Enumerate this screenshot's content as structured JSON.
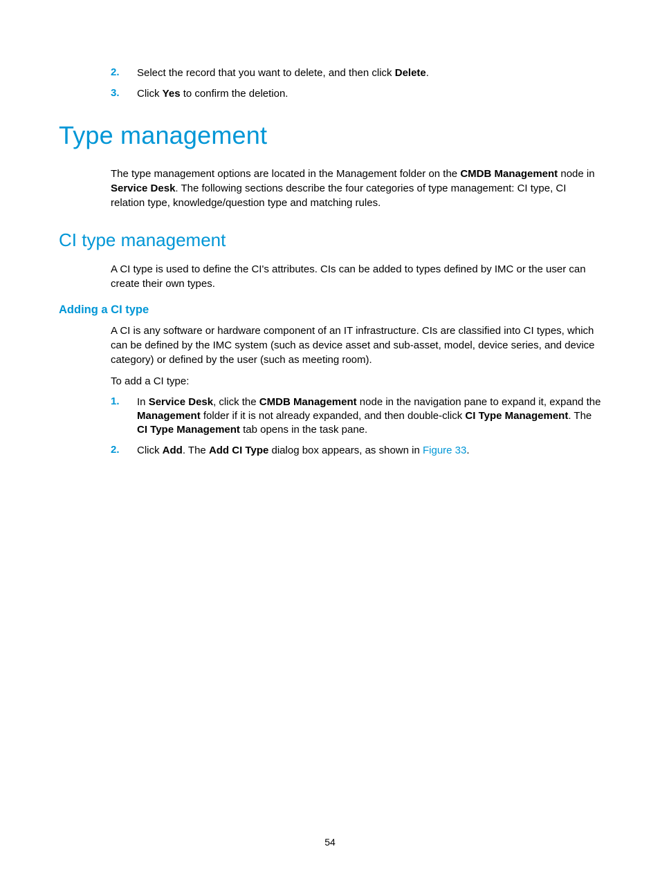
{
  "top_list": {
    "item2": {
      "num": "2.",
      "pre": "Select the record that you want to delete, and then click ",
      "bold": "Delete",
      "post": "."
    },
    "item3": {
      "num": "3.",
      "pre": "Click ",
      "bold": "Yes",
      "post": " to confirm the deletion."
    }
  },
  "h1": "Type management",
  "para1": {
    "t1": "The type management options are located in the Management folder on the ",
    "b1": "CMDB Management",
    "t2": " node in ",
    "b2": "Service Desk",
    "t3": ". The following sections describe the four categories of type management: CI type, CI relation type, knowledge/question type and matching rules."
  },
  "h2": "CI type management",
  "para2": "A CI type is used to define the CI's attributes. CIs can be added to types defined by IMC or the user can create their own types.",
  "h3": "Adding a CI type",
  "para3": "A CI is any software or hardware component of an IT infrastructure. CIs are classified into CI types, which can be defined by the IMC system (such as device asset and sub-asset, model, device series, and device category) or defined by the user (such as meeting room).",
  "para4": "To add a CI type:",
  "step1": {
    "num": "1.",
    "t1": "In ",
    "b1": "Service Desk",
    "t2": ", click the ",
    "b2": "CMDB Management",
    "t3": " node in the navigation pane to expand it, expand the ",
    "b3": "Management",
    "t4": " folder if it is not already expanded, and then double-click ",
    "b4": "CI Type Management",
    "t5": ". The ",
    "b5": "CI Type Management",
    "t6": " tab opens in the task pane."
  },
  "step2": {
    "num": "2.",
    "t1": "Click ",
    "b1": "Add",
    "t2": ". The ",
    "b2": "Add CI Type",
    "t3": " dialog box appears, as shown in ",
    "link": "Figure 33",
    "t4": "."
  },
  "pagenum": "54"
}
